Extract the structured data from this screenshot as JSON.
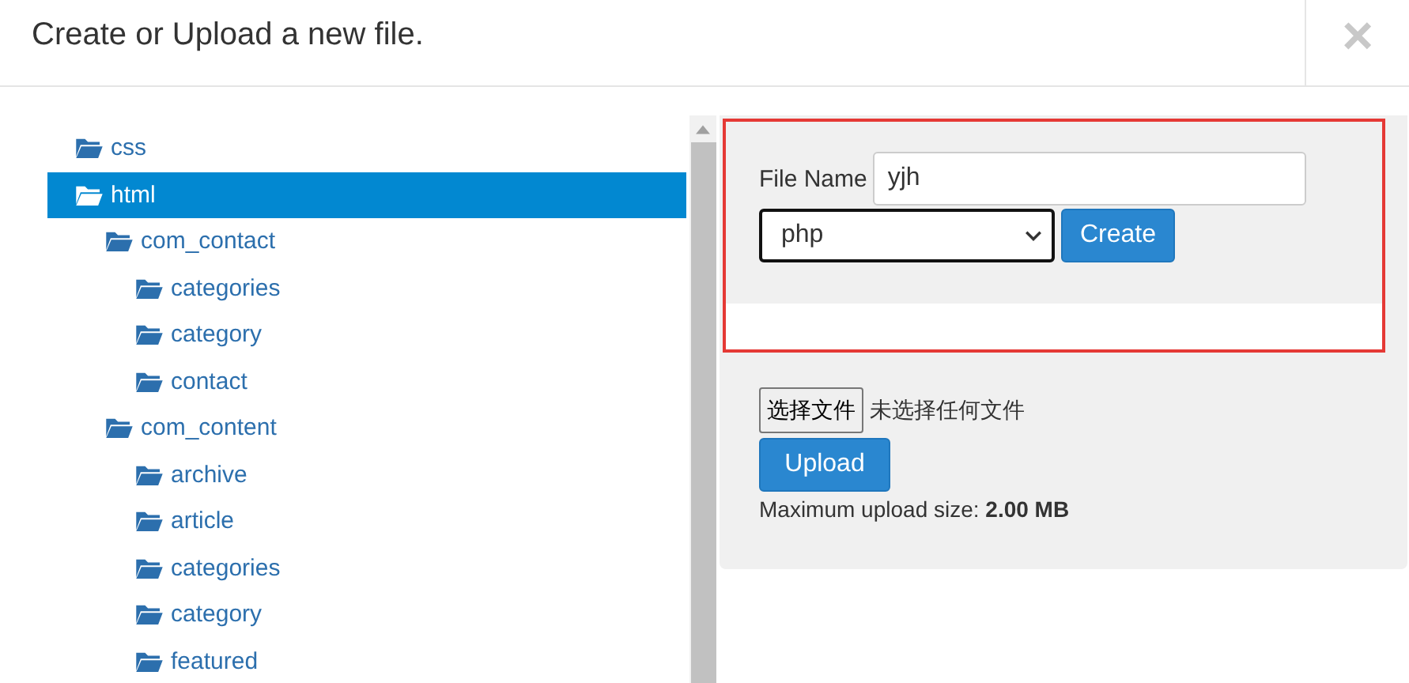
{
  "dialog": {
    "title": "Create or Upload a new file.",
    "close": "×"
  },
  "tree": [
    {
      "label": "css",
      "selected": false
    },
    {
      "label": "html",
      "selected": true,
      "children": [
        {
          "label": "com_contact",
          "selected": false,
          "children": [
            {
              "label": "categories",
              "selected": false
            },
            {
              "label": "category",
              "selected": false
            },
            {
              "label": "contact",
              "selected": false
            }
          ]
        },
        {
          "label": "com_content",
          "selected": false,
          "children": [
            {
              "label": "archive",
              "selected": false
            },
            {
              "label": "article",
              "selected": false
            },
            {
              "label": "categories",
              "selected": false
            },
            {
              "label": "category",
              "selected": false
            },
            {
              "label": "featured",
              "selected": false
            }
          ]
        }
      ]
    }
  ],
  "create_form": {
    "label": "File Name",
    "value": "yjh",
    "type_value": "php",
    "button": "Create"
  },
  "upload_form": {
    "choose_button": "选择文件",
    "no_file": "未选择任何文件",
    "button": "Upload",
    "max_size": "Maximum upload size: **2.00 MB**"
  }
}
